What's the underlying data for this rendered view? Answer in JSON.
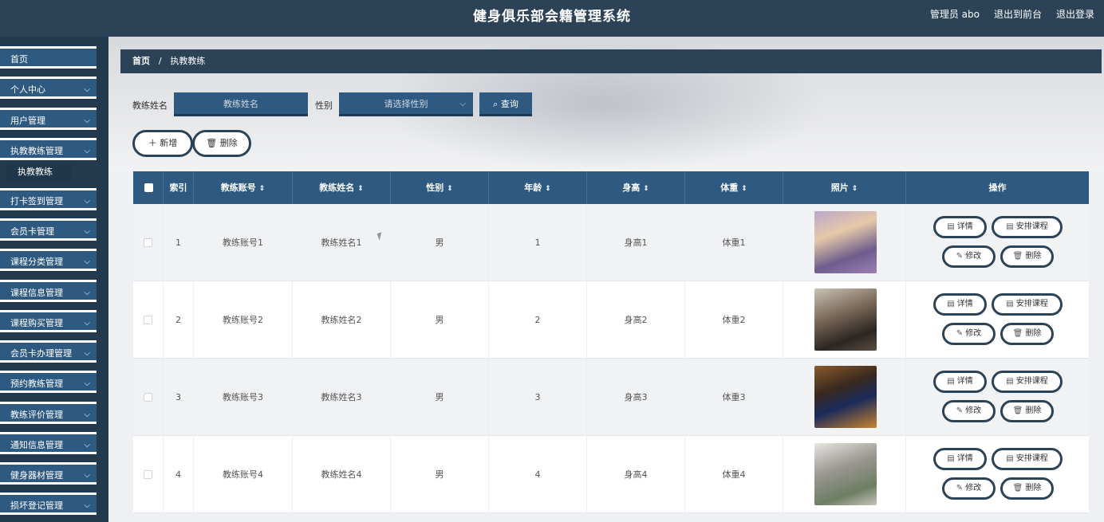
{
  "header": {
    "title": "健身俱乐部会籍管理系统",
    "admin": "管理员 abo",
    "to_front": "退出到前台",
    "logout": "退出登录"
  },
  "sidebar": {
    "items": [
      {
        "label": "首页",
        "chevron": false
      },
      {
        "label": "个人中心",
        "chevron": true
      },
      {
        "label": "用户管理",
        "chevron": true
      },
      {
        "label": "执教教练管理",
        "chevron": true
      },
      {
        "label": "打卡签到管理",
        "chevron": true
      },
      {
        "label": "会员卡管理",
        "chevron": true
      },
      {
        "label": "课程分类管理",
        "chevron": true
      },
      {
        "label": "课程信息管理",
        "chevron": true
      },
      {
        "label": "课程购买管理",
        "chevron": true
      },
      {
        "label": "会员卡办理管理",
        "chevron": true
      },
      {
        "label": "预约教练管理",
        "chevron": true
      },
      {
        "label": "教练评价管理",
        "chevron": true
      },
      {
        "label": "通知信息管理",
        "chevron": true
      },
      {
        "label": "健身器材管理",
        "chevron": true
      },
      {
        "label": "损坏登记管理",
        "chevron": true
      }
    ],
    "sub_active": "执教教练"
  },
  "breadcrumb": {
    "home": "首页",
    "sep": "/",
    "current": "执教教练"
  },
  "search": {
    "name_label": "教练姓名",
    "name_placeholder": "教练姓名",
    "gender_label": "性别",
    "gender_placeholder": "请选择性别",
    "query_label": "查询"
  },
  "actions": {
    "add": "新增",
    "delete": "删除"
  },
  "table": {
    "headers": [
      "索引",
      "教练账号",
      "教练姓名",
      "性别",
      "年龄",
      "身高",
      "体重",
      "照片",
      "操作"
    ],
    "rows": [
      {
        "index": "1",
        "account": "教练账号1",
        "name": "教练姓名1",
        "gender": "男",
        "age": "1",
        "height": "身高1",
        "weight": "体重1",
        "photo": "photo-1"
      },
      {
        "index": "2",
        "account": "教练账号2",
        "name": "教练姓名2",
        "gender": "男",
        "age": "2",
        "height": "身高2",
        "weight": "体重2",
        "photo": "photo-2"
      },
      {
        "index": "3",
        "account": "教练账号3",
        "name": "教练姓名3",
        "gender": "男",
        "age": "3",
        "height": "身高3",
        "weight": "体重3",
        "photo": "photo-3"
      },
      {
        "index": "4",
        "account": "教练账号4",
        "name": "教练姓名4",
        "gender": "男",
        "age": "4",
        "height": "身高4",
        "weight": "体重4",
        "photo": "photo-4"
      }
    ],
    "row_actions": {
      "detail": "详情",
      "schedule": "安排课程",
      "edit": "修改",
      "delete": "删除"
    }
  },
  "colors": {
    "header_bg": "#2b4257",
    "accent": "#2e5a82",
    "sidebar_bg": "#233a4e"
  }
}
